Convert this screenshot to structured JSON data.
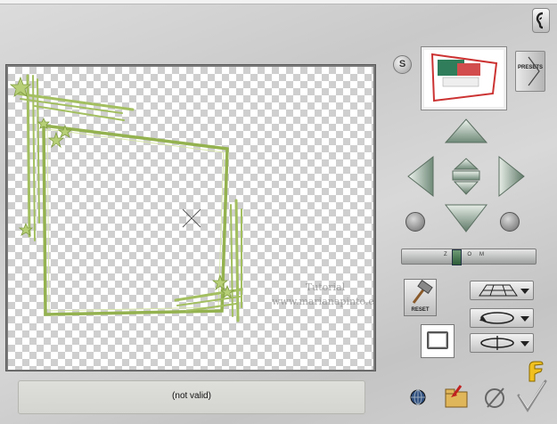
{
  "status": {
    "text": "(not valid)"
  },
  "watermark": {
    "line1": "Tutorial",
    "line2": "www.marianapinto.eu"
  },
  "buttons": {
    "s_label": "S",
    "presets_label": "PRESETS",
    "reset_label": "RESET"
  },
  "zoom": {
    "label": "ZOOM",
    "level": 0.4
  },
  "icons": {
    "s": "s-icon",
    "ear": "ear-icon",
    "presets": "chevron-right-icon",
    "up": "arrow-up-icon",
    "down": "arrow-down-icon",
    "left": "arrow-left-icon",
    "right": "arrow-right-icon",
    "rotate_left": "rotate-left-icon",
    "rotate_right": "rotate-right-icon",
    "reset": "hammer-icon",
    "grid_mode": "perspective-grid-icon",
    "rotate_mode": "rotate-loop-icon",
    "flip_mode": "flip-loop-icon",
    "frame": "frame-icon",
    "globe": "globe-icon",
    "import": "folder-import-icon",
    "cancel": "cancel-icon",
    "ok": "check-icon",
    "help": "pointing-hand-icon"
  },
  "colors": {
    "frame_green": "#9dba5b",
    "panel": "#d0d0d0",
    "status_bg": "#d8d8d4"
  }
}
